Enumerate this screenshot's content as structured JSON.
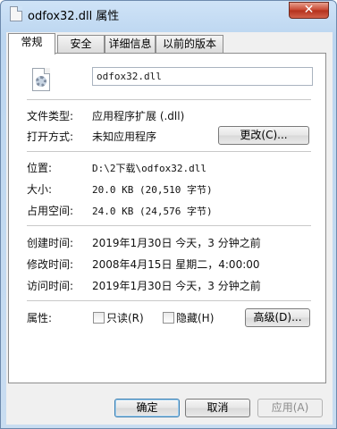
{
  "window": {
    "title": "odfox32.dll 属性",
    "close_glyph": "✕"
  },
  "tabs": [
    {
      "label": "常规",
      "active": true
    },
    {
      "label": "安全",
      "active": false
    },
    {
      "label": "详细信息",
      "active": false
    },
    {
      "label": "以前的版本",
      "active": false
    }
  ],
  "general": {
    "file_name": "odfox32.dll",
    "file_type_label": "文件类型:",
    "file_type_value": "应用程序扩展 (.dll)",
    "opens_with_label": "打开方式:",
    "opens_with_value": "未知应用程序",
    "change_button": "更改(C)...",
    "location_label": "位置:",
    "location_value": "D:\\2下载\\odfox32.dll",
    "size_label": "大小:",
    "size_value": "20.0 KB (20,510 字节)",
    "size_on_disk_label": "占用空间:",
    "size_on_disk_value": "24.0 KB (24,576 字节)",
    "created_label": "创建时间:",
    "created_value": "2019年1月30日 今天，3 分钟之前",
    "modified_label": "修改时间:",
    "modified_value": "2008年4月15日 星期二，4:00:00",
    "accessed_label": "访问时间:",
    "accessed_value": "2019年1月30日 今天，3 分钟之前",
    "attributes_label": "属性:",
    "readonly_label": "只读(R)",
    "readonly_checked": false,
    "hidden_label": "隐藏(H)",
    "hidden_checked": false,
    "advanced_button": "高级(D)..."
  },
  "footer": {
    "ok_button": "确定",
    "cancel_button": "取消",
    "apply_button": "应用(A)"
  },
  "icons": {
    "title_icon": "file-icon",
    "file_icon": "dll-settings-file-icon"
  }
}
